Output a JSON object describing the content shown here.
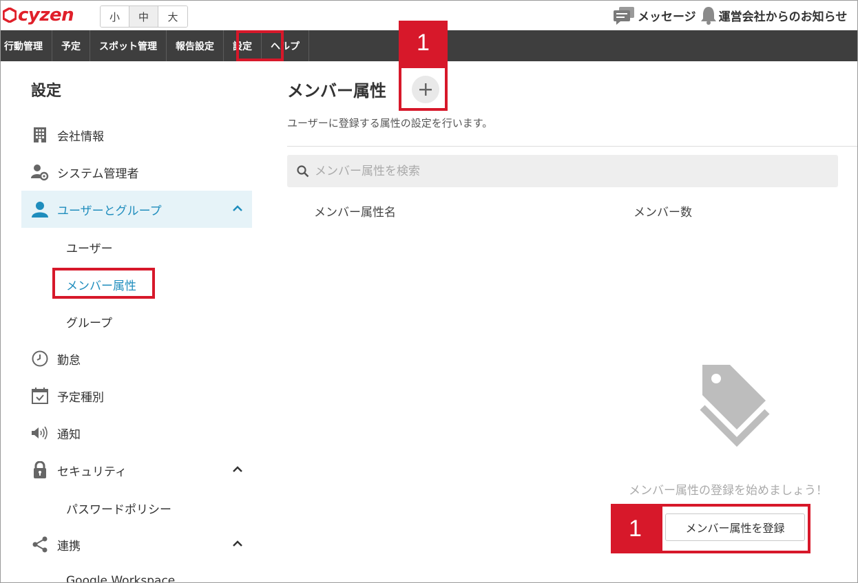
{
  "brand": {
    "name": "cyzen",
    "color": "#e0202a"
  },
  "font_size": {
    "options": [
      "小",
      "中",
      "大"
    ],
    "selected": "中"
  },
  "header_right": {
    "messages_label": "メッセージ",
    "notices_label": "運営会社からのお知らせ"
  },
  "nav": {
    "items": [
      "行動管理",
      "予定",
      "スポット管理",
      "報告設定",
      "設定",
      "ヘルプ"
    ],
    "active": "設定"
  },
  "sidebar": {
    "title": "設定",
    "items": [
      {
        "label": "会社情報",
        "icon": "building-icon"
      },
      {
        "label": "システム管理者",
        "icon": "admin-user-gear-icon"
      },
      {
        "label": "ユーザーとグループ",
        "icon": "user-icon",
        "expanded": true,
        "active": true
      },
      {
        "label": "勤怠",
        "icon": "clock-icon"
      },
      {
        "label": "予定種別",
        "icon": "calendar-check-icon"
      },
      {
        "label": "通知",
        "icon": "speaker-icon"
      },
      {
        "label": "セキュリティ",
        "icon": "lock-icon",
        "expanded": true
      },
      {
        "label": "連携",
        "icon": "share-icon",
        "expanded": true
      }
    ],
    "users_sub": [
      "ユーザー",
      "メンバー属性",
      "グループ"
    ],
    "security_sub": [
      "パスワードポリシー"
    ],
    "integration_sub": [
      "Google Workspace"
    ]
  },
  "main": {
    "title": "メンバー属性",
    "description": "ユーザーに登録する属性の設定を行います。",
    "search_placeholder": "メンバー属性を検索",
    "columns": [
      "メンバー属性名",
      "メンバー数"
    ],
    "empty_message": "メンバー属性の登録を始めましょう！",
    "register_button": "メンバー属性を登録"
  },
  "annotations": {
    "step_top": "1",
    "step_bottom": "1",
    "color": "#d7182a"
  },
  "colors": {
    "nav_bg": "#3e3e3e",
    "accent": "#1f8dbd",
    "active_bg": "#e6f3f8"
  }
}
